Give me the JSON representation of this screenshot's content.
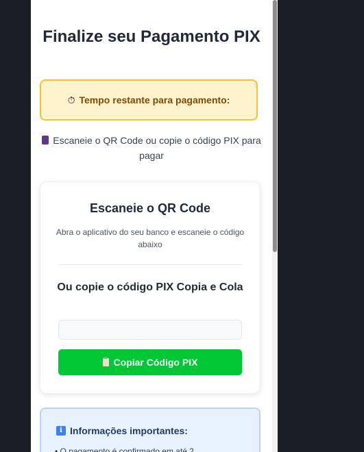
{
  "title": "Finalize seu Pagamento PIX",
  "timer": {
    "icon": "stopwatch-icon",
    "label": "Tempo restante para pagamento:"
  },
  "instruction": {
    "icon": "phone-icon",
    "text": "Escaneie o QR Code ou copie o código PIX para pagar"
  },
  "qr_card": {
    "title": "Escaneie o QR Code",
    "subtitle": "Abra o aplicativo do seu banco e escaneie o código abaixo",
    "copy_title": "Ou copie o código PIX Copia e Cola",
    "pix_code_value": "",
    "copy_button_label": "Copiar Código PIX",
    "copy_button_icon": "clipboard-icon"
  },
  "info": {
    "icon": "info-icon",
    "title": "Informações importantes:",
    "items": [
      "• O pagamento é confirmado em até 2"
    ]
  },
  "colors": {
    "background": "#1b1e25",
    "timer_bg": "#fff3cd",
    "timer_border": "#fbc02d",
    "button": "#00c835",
    "info_bg": "#e8f2ff",
    "info_border": "#b6d4fe"
  }
}
